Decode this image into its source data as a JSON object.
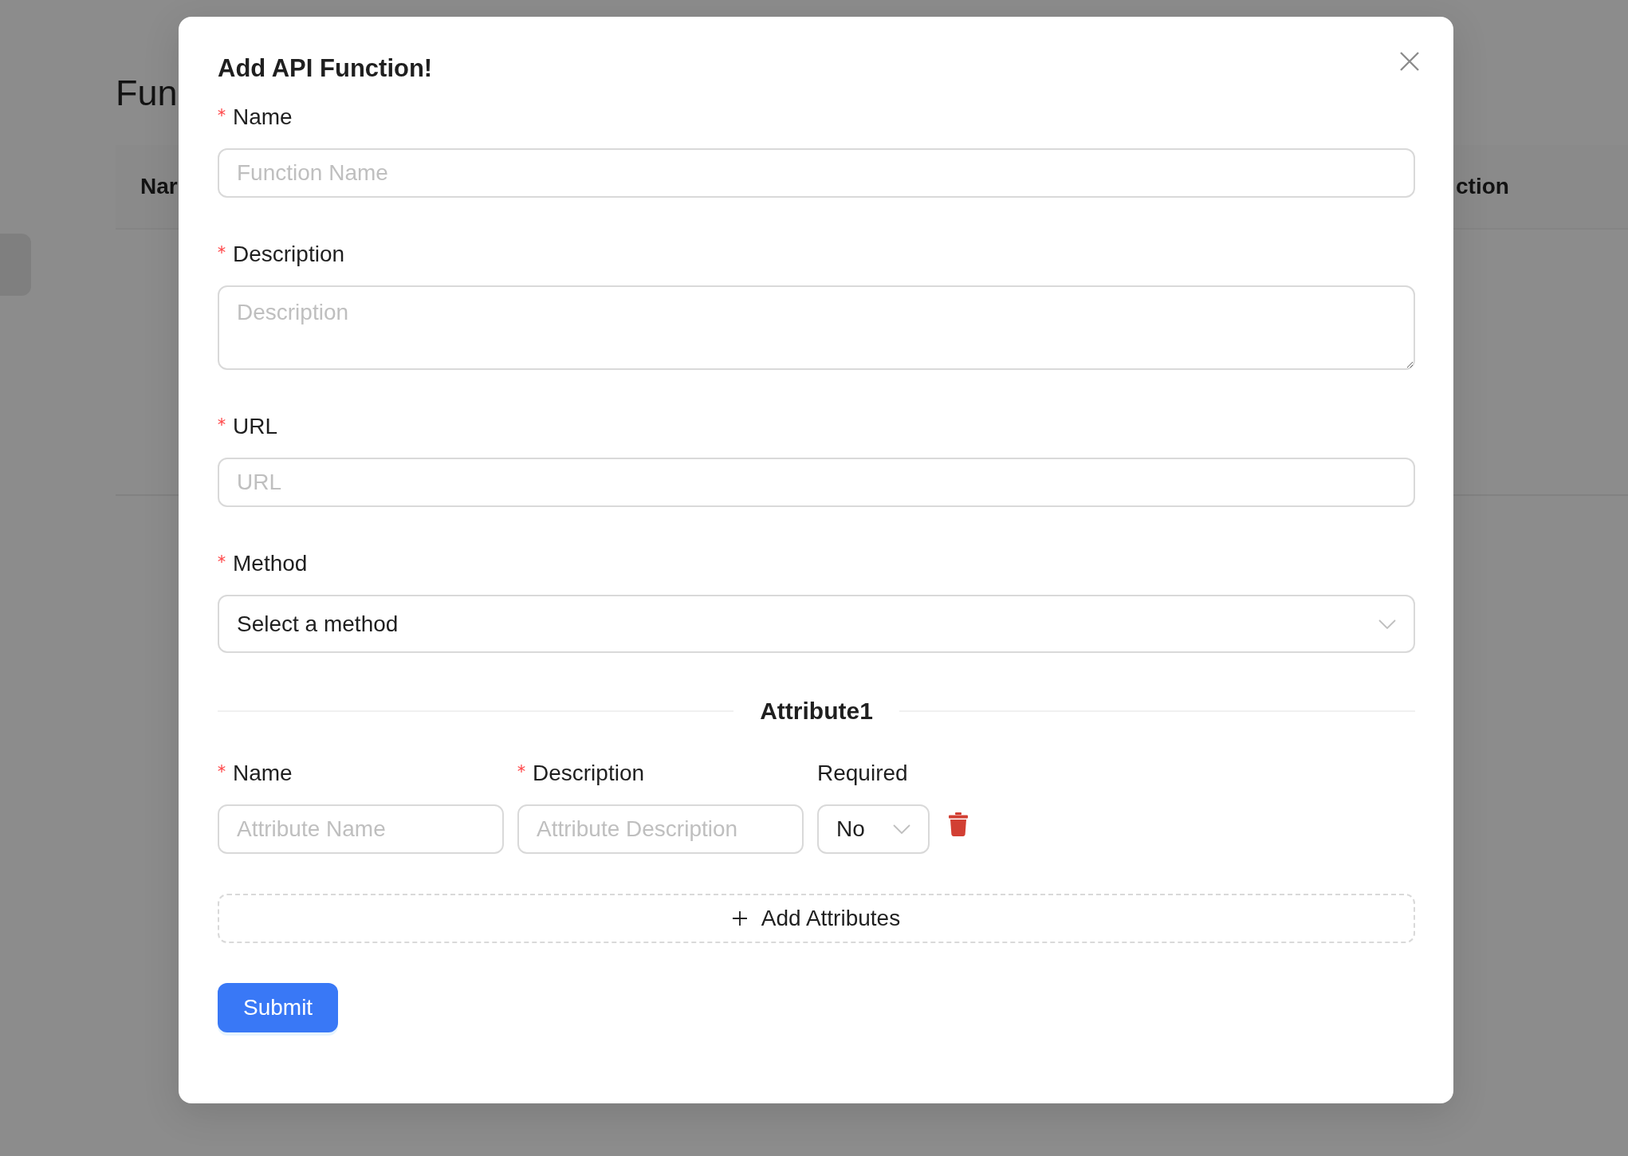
{
  "background_page": {
    "sidebar": {
      "items": [
        {
          "selected": true
        }
      ]
    },
    "title": "Fun",
    "table": {
      "columns": [
        "Nar",
        "ction"
      ]
    }
  },
  "modal": {
    "title": "Add API Function!",
    "fields": [
      {
        "kind": "input",
        "label": "Name",
        "required": true,
        "placeholder": "Function Name"
      },
      {
        "kind": "textarea",
        "label": "Description",
        "required": true,
        "placeholder": "Description"
      },
      {
        "kind": "input",
        "label": "URL",
        "required": true,
        "placeholder": "URL"
      },
      {
        "kind": "select",
        "label": "Method",
        "required": true,
        "value": "Select a method"
      }
    ],
    "attributes": [
      {
        "title": "Attribute1",
        "fields": [
          {
            "kind": "input",
            "label": "Name",
            "required": true,
            "placeholder": "Attribute Name"
          },
          {
            "kind": "input",
            "label": "Description",
            "required": true,
            "placeholder": "Attribute Description"
          },
          {
            "kind": "select",
            "label": "Required",
            "required": false,
            "value": "No"
          }
        ]
      }
    ],
    "add_button": {
      "label": "Add Attributes"
    },
    "submit_button": {
      "label": "Submit"
    }
  }
}
